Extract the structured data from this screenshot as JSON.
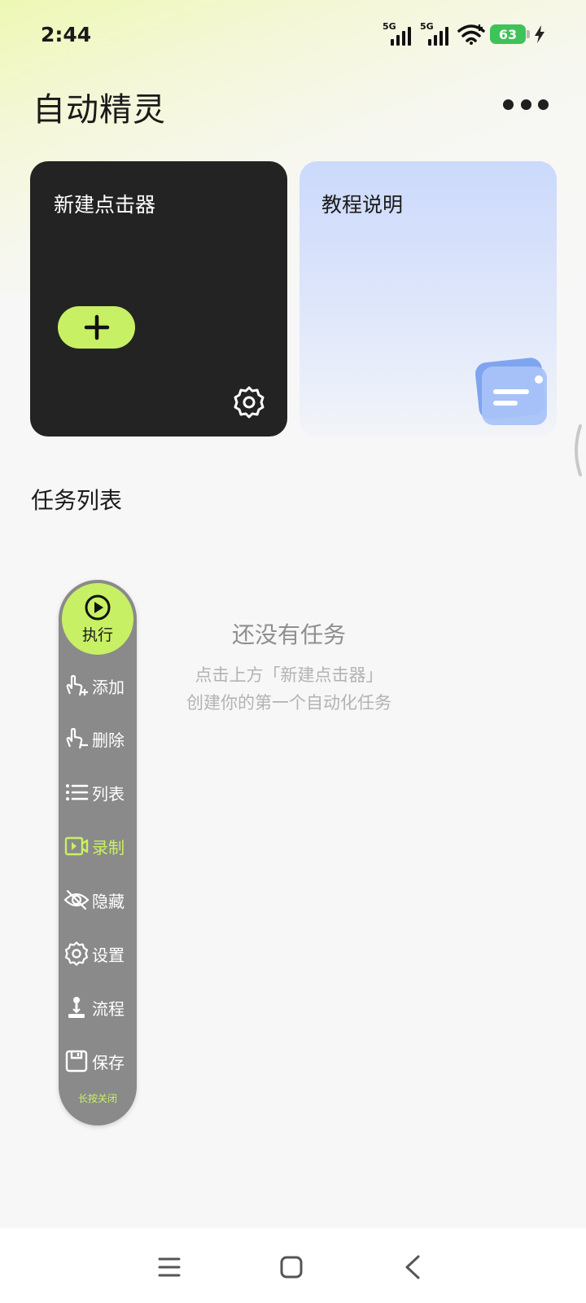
{
  "status_bar": {
    "time": "2:44",
    "sim1": "5G",
    "sim2": "5G",
    "battery": "63"
  },
  "header": {
    "title": "自动精灵"
  },
  "cards": {
    "new_clicker": "新建点击器",
    "tutorial": "教程说明"
  },
  "tasks": {
    "section_title": "任务列表",
    "empty_title": "还没有任务",
    "empty_line1": "点击上方「新建点击器」",
    "empty_line2": "创建你的第一个自动化任务"
  },
  "float_panel": {
    "execute": "执行",
    "items": [
      {
        "label": "添加",
        "icon": "tap-add-icon"
      },
      {
        "label": "删除",
        "icon": "tap-remove-icon"
      },
      {
        "label": "列表",
        "icon": "list-icon"
      },
      {
        "label": "录制",
        "icon": "record-icon"
      },
      {
        "label": "隐藏",
        "icon": "eye-off-icon"
      },
      {
        "label": "设置",
        "icon": "gear-icon"
      },
      {
        "label": "流程",
        "icon": "flow-icon"
      },
      {
        "label": "保存",
        "icon": "save-icon"
      }
    ],
    "footer": "长按关闭"
  },
  "colors": {
    "accent": "#c8f064",
    "card_dark": "#232323",
    "panel": "#8a8a8a"
  }
}
